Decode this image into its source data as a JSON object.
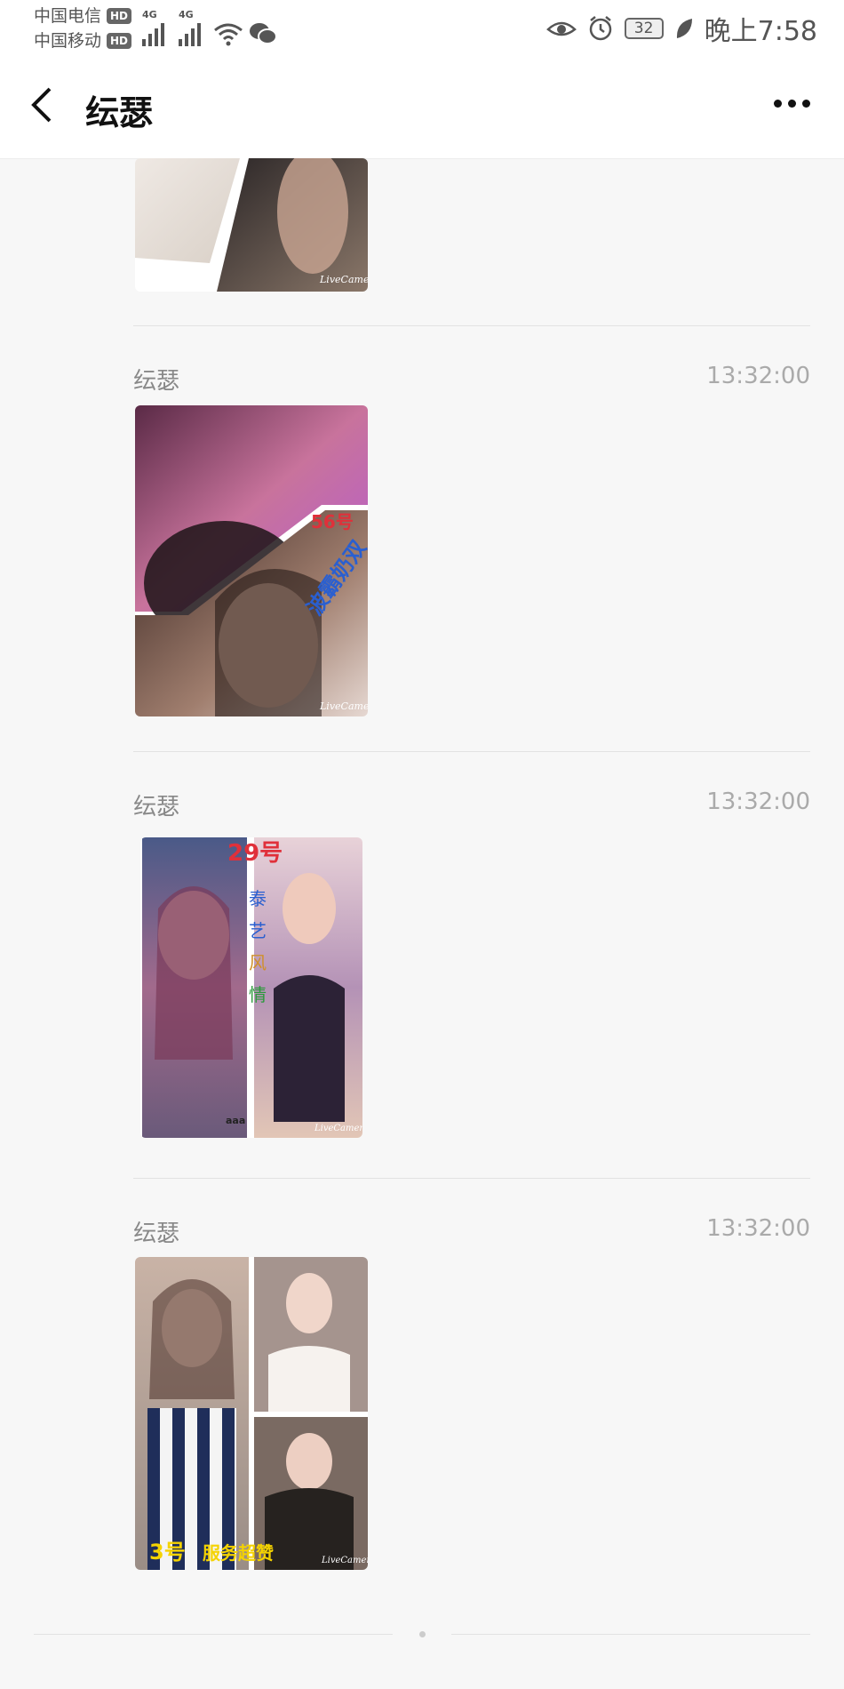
{
  "status_bar": {
    "carrier_1": "中国电信",
    "carrier_2": "中国移动",
    "hd_badge": "HD",
    "network": "4G",
    "battery": "32",
    "time": "晚上7:58"
  },
  "nav": {
    "title": "纭瑟",
    "back_icon": "chevron-left-icon",
    "more_icon": "more-dots-icon"
  },
  "messages": [
    {
      "sender": "",
      "time": ""
    },
    {
      "sender": "纭瑟",
      "time": "13:32:00",
      "overlay_text": [
        "56号",
        "波霸奶双"
      ]
    },
    {
      "sender": "纭瑟",
      "time": "13:32:00",
      "overlay_text": [
        "29号",
        "泰",
        "艺",
        "风",
        "情",
        "aaa"
      ]
    },
    {
      "sender": "纭瑟",
      "time": "13:32:00",
      "overlay_text": [
        "3号",
        "服务超赞"
      ]
    }
  ],
  "watermark": "LiveCamera",
  "colors": {
    "accent_red": "#e0303a",
    "overlay_blue": "#2a5fd0",
    "overlay_yellow": "#f5d300"
  }
}
